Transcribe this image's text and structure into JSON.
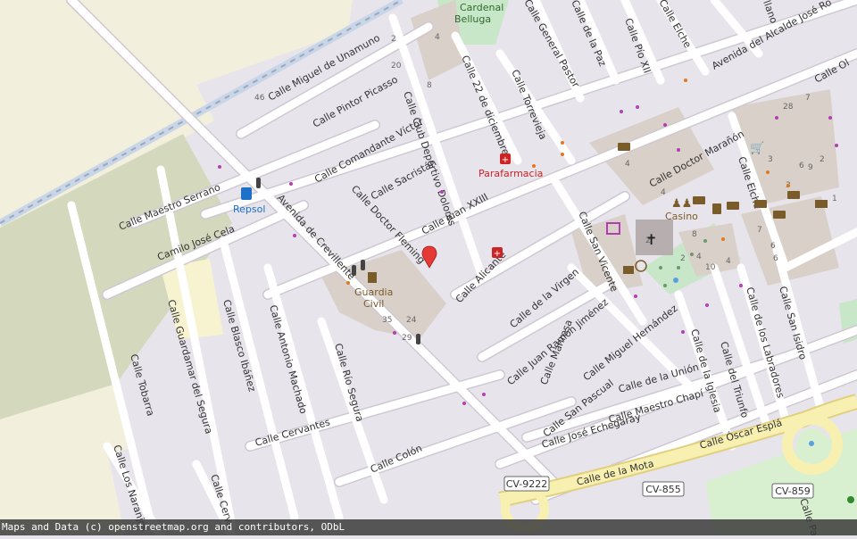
{
  "map": {
    "colors": {
      "background": "#e8e4ec",
      "road": "#ffffff",
      "road_casing": "#cfc8d3",
      "field": "#f2efdc",
      "farmland": "#d4d9bd",
      "park": "#c8e6c8",
      "marker": "#e53935",
      "pharmacy": "#cc2424",
      "fuel": "#1e70c8",
      "poi_brown": "#7a5c2a",
      "building": "#d9d0c9",
      "yellow_road": "#f7f0b0"
    },
    "streets": [
      "Calle Miguel de Unamuno",
      "Calle Pintor Picasso",
      "Calle Comandante Víctor",
      "Calle Club Deportivo Dolores",
      "Calle 22 de diciembre",
      "Calle Torrevieja",
      "Calle General Pastor",
      "Calle de la Paz",
      "Calle Pío XII",
      "Calle Elche",
      "Avenida del Alcalde José Ro",
      "Calle Ol",
      "llano",
      "Calle Maestro Serrano",
      "Calle Sacristán",
      "Avenida de Crevillente",
      "Calle Doctor Fleming",
      "Calle Juan XXIII",
      "Camilo José Cela",
      "Calle Doctor Marañón",
      "Calle Elche",
      "Calle San Vicente",
      "Calle Alicante",
      "Calle de la Virgen",
      "Calle Juan Ramón Jiménez",
      "Calle Guardamar del Segura",
      "Calle Blasco Ibáñez",
      "Calle Antonio Machado",
      "Calle Río Segura",
      "Calle Tobarra",
      "Calle Manresa",
      "Calle Miguel Hernández",
      "Calle de la Iglesia",
      "Calle del Triunfo",
      "Calle de los Labradores",
      "Calle San Isidro",
      "Calle de la Unión",
      "Calle San Pascual",
      "Calle Maestro Chapí",
      "Calle José Echegaray",
      "Calle Óscar Esplá",
      "Calle Cervantes",
      "Calle Colón",
      "Calle de la Mota",
      "Calle Los Naranjos",
      "Calle Cerva",
      "Calle Pa"
    ],
    "road_shields": [
      "CV-9222",
      "CV-855",
      "CV-859"
    ],
    "pois": {
      "cardenal": "Cardenal",
      "belluga": "Belluga",
      "parafarmacia": "Parafarmacia",
      "repsol": "Repsol",
      "guardia": "Guardia",
      "civil": "Civil",
      "casino": "Casino"
    },
    "house_numbers": [
      "2",
      "20",
      "46",
      "8",
      "4",
      "35",
      "24",
      "29",
      "28",
      "7",
      "3",
      "9",
      "6",
      "2",
      "4",
      "1",
      "3",
      "2",
      "10",
      "4",
      "4",
      "7",
      "6",
      "6",
      "4",
      "8",
      "2"
    ],
    "icons": [
      "map-pin-icon",
      "pharmacy-icon",
      "fuel-icon",
      "police-icon",
      "church-icon",
      "bank-icon",
      "shop-icon",
      "mail-icon",
      "theatre-icon",
      "info-icon",
      "playground-icon",
      "traffic-signal-icon"
    ]
  },
  "attribution": "Maps and Data (c) openstreetmap.org and contributors, ODbL"
}
